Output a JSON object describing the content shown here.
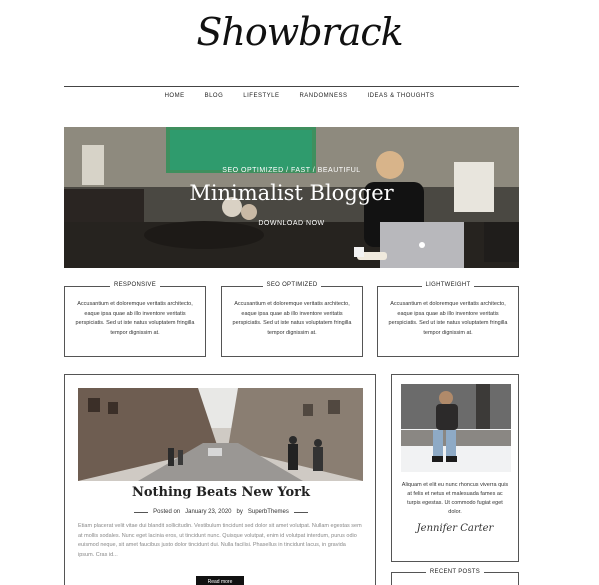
{
  "brand": {
    "logo": "Showbrack"
  },
  "nav": [
    "HOME",
    "BLOG",
    "LIFESTYLE",
    "RANDOMNESS",
    "IDEAS & THOUGHTS"
  ],
  "hero": {
    "subtitle": "SEO OPTIMIZED / FAST / BEAUTIFUL",
    "title": "Minimalist Blogger",
    "cta": "DOWNLOAD NOW"
  },
  "features": [
    {
      "title": "RESPONSIVE",
      "text": "Accusantium et doloremque veritatis architecto, eaque ipsa quae ab illo inventore veritatis perspiciatis. Sed ut iste natus voluptatem fringilla tempor dignissim at."
    },
    {
      "title": "SEO OPTIMIZED",
      "text": "Accusantium et doloremque veritatis architecto, eaque ipsa quae ab illo inventore veritatis perspiciatis. Sed ut iste natus voluptatem fringilla tempor dignissim at."
    },
    {
      "title": "LIGHTWEIGHT",
      "text": "Accusantium et doloremque veritatis architecto, eaque ipsa quae ab illo inventore veritatis perspiciatis. Sed ut iste natus voluptatem fringilla tempor dignissim at."
    }
  ],
  "post": {
    "title": "Nothing Beats New York",
    "meta_prefix": "Posted on",
    "date": "January 23, 2020",
    "meta_by": "by",
    "author": "SuperbThemes",
    "excerpt": "Etiam placerat velit vitae dui blandit sollicitudin. Vestibulum tincidunt sed dolor sit amet volutpat. Nullam egestas sem at mollis sodales. Nunc eget lacinia eros, ut tincidunt nunc. Quisque volutpat, enim id volutpat interdum, purus odio euismod neque, sit amet faucibus justo dolor tincidunt dui. Nulla facilisi. Phasellus in tincidunt lacus, in gravida ipsum. Cras id...",
    "read_more": "Read more"
  },
  "sidebar": {
    "about_text": "Aliquam et elit eu nunc rhoncus viverra quis at felis et netus et malesuada fames ac turpis egestas. Ut commodo fugiat eget dolor.",
    "signature": "Jennifer Carter",
    "recent_title": "RECENT POSTS"
  }
}
